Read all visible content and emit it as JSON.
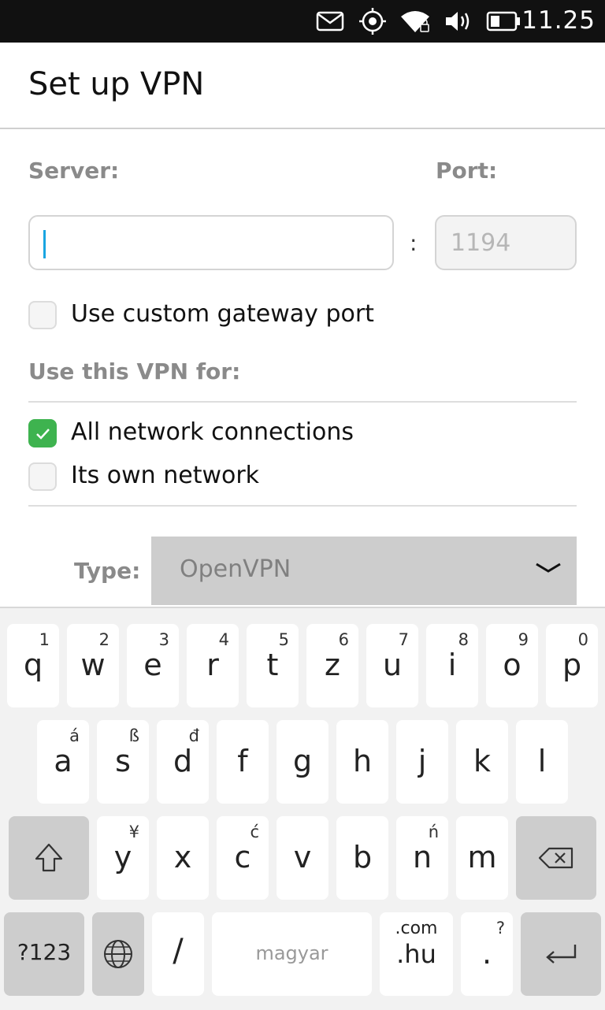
{
  "status_bar": {
    "time": "11.25",
    "icons": [
      "mail-icon",
      "location-icon",
      "wifi-icon",
      "volume-icon",
      "battery-icon"
    ]
  },
  "header": {
    "title": "Set up VPN"
  },
  "form": {
    "server_label": "Server:",
    "server_value": "",
    "port_label": "Port:",
    "port_placeholder": "1194",
    "separator": ":",
    "custom_gateway_label": "Use custom gateway port",
    "custom_gateway_checked": false,
    "use_for_label": "Use this VPN for:",
    "options": [
      {
        "label": "All network connections",
        "checked": true
      },
      {
        "label": "Its own network",
        "checked": false
      }
    ],
    "type_label": "Type:",
    "type_value": "OpenVPN"
  },
  "keyboard": {
    "rows": [
      [
        {
          "k": "q",
          "s": "1"
        },
        {
          "k": "w",
          "s": "2"
        },
        {
          "k": "e",
          "s": "3"
        },
        {
          "k": "r",
          "s": "4"
        },
        {
          "k": "t",
          "s": "5"
        },
        {
          "k": "z",
          "s": "6"
        },
        {
          "k": "u",
          "s": "7"
        },
        {
          "k": "i",
          "s": "8"
        },
        {
          "k": "o",
          "s": "9"
        },
        {
          "k": "p",
          "s": "0"
        }
      ],
      [
        {
          "k": "a",
          "s": "á"
        },
        {
          "k": "s",
          "s": "ß"
        },
        {
          "k": "d",
          "s": "đ"
        },
        {
          "k": "f",
          "s": ""
        },
        {
          "k": "g",
          "s": ""
        },
        {
          "k": "h",
          "s": ""
        },
        {
          "k": "j",
          "s": ""
        },
        {
          "k": "k",
          "s": ""
        },
        {
          "k": "l",
          "s": ""
        }
      ],
      [
        {
          "k": "y",
          "s": "¥"
        },
        {
          "k": "x",
          "s": ""
        },
        {
          "k": "c",
          "s": "ć"
        },
        {
          "k": "v",
          "s": ""
        },
        {
          "k": "b",
          "s": ""
        },
        {
          "k": "n",
          "s": "ń"
        },
        {
          "k": "m",
          "s": ""
        }
      ]
    ],
    "symbols_key": "?123",
    "slash_key": "/",
    "space_label": "magyar",
    "domain_key": ".hu",
    "domain_sub": ".com",
    "period_key": ".",
    "period_sub": "?"
  },
  "colors": {
    "accent_green": "#3eb34f",
    "caret_blue": "#19a5e1",
    "status_bar": "#111111"
  }
}
